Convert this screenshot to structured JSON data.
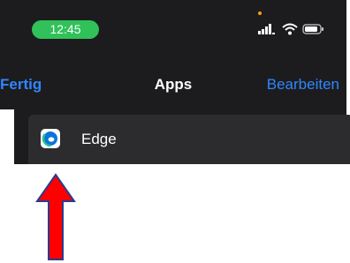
{
  "status_bar": {
    "time": "12:45",
    "icons": [
      "signal-icon",
      "wifi-icon",
      "battery-icon"
    ],
    "pill_color": "#30c15a"
  },
  "nav": {
    "left_label": "Fertig",
    "title": "Apps",
    "right_label": "Bearbeiten",
    "accent_color": "#2f86ff"
  },
  "apps": [
    {
      "name": "Edge",
      "icon": "edge-icon"
    }
  ],
  "annotation": {
    "type": "arrow",
    "color": "#ff0000",
    "icon": "arrow-up-icon"
  }
}
